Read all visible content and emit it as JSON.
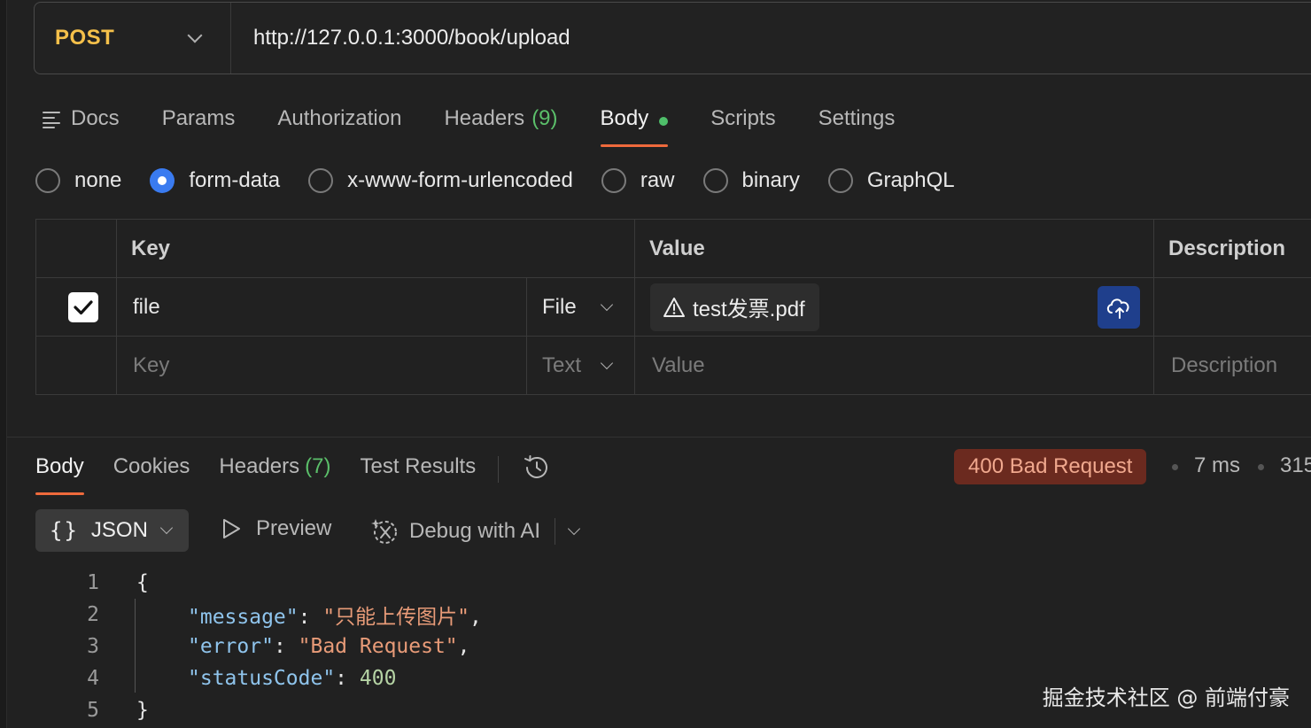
{
  "request": {
    "method": "POST",
    "url": "http://127.0.0.1:3000/book/upload"
  },
  "request_tabs": {
    "docs": "Docs",
    "params": "Params",
    "authorization": "Authorization",
    "headers": "Headers",
    "headers_count": "(9)",
    "body": "Body",
    "scripts": "Scripts",
    "settings": "Settings"
  },
  "body_types": {
    "none": "none",
    "form_data": "form-data",
    "urlencoded": "x-www-form-urlencoded",
    "raw": "raw",
    "binary": "binary",
    "graphql": "GraphQL",
    "selected": "form-data"
  },
  "form_table": {
    "headers": {
      "key": "Key",
      "value": "Value",
      "description": "Description"
    },
    "row1": {
      "checked": true,
      "key": "file",
      "type": "File",
      "value": "test发票.pdf",
      "description": ""
    },
    "row2": {
      "key_placeholder": "Key",
      "type": "Text",
      "value_placeholder": "Value",
      "description_placeholder": "Description"
    }
  },
  "response_tabs": {
    "body": "Body",
    "cookies": "Cookies",
    "headers": "Headers",
    "headers_count": "(7)",
    "test_results": "Test Results"
  },
  "response_meta": {
    "status": "400 Bad Request",
    "time": "7 ms",
    "size_partial": "315"
  },
  "response_toolbar": {
    "format": "JSON",
    "preview": "Preview",
    "debug": "Debug with AI"
  },
  "response_body": {
    "line_numbers": [
      "1",
      "2",
      "3",
      "4",
      "5"
    ],
    "open_brace": "{",
    "close_brace": "}",
    "k_message": "\"message\"",
    "v_message": "\"只能上传图片\"",
    "k_error": "\"error\"",
    "v_error": "\"Bad Request\"",
    "k_status": "\"statusCode\"",
    "v_status": "400"
  },
  "watermark": "掘金技术社区 @ 前端付豪",
  "colors": {
    "method": "#f5c04a",
    "accent_tab": "#ef6a3c",
    "radio_selected": "#3a7bf0",
    "status_bg": "#6b2a1f",
    "status_text": "#f0a88e",
    "count_green": "#5bbf6a"
  }
}
